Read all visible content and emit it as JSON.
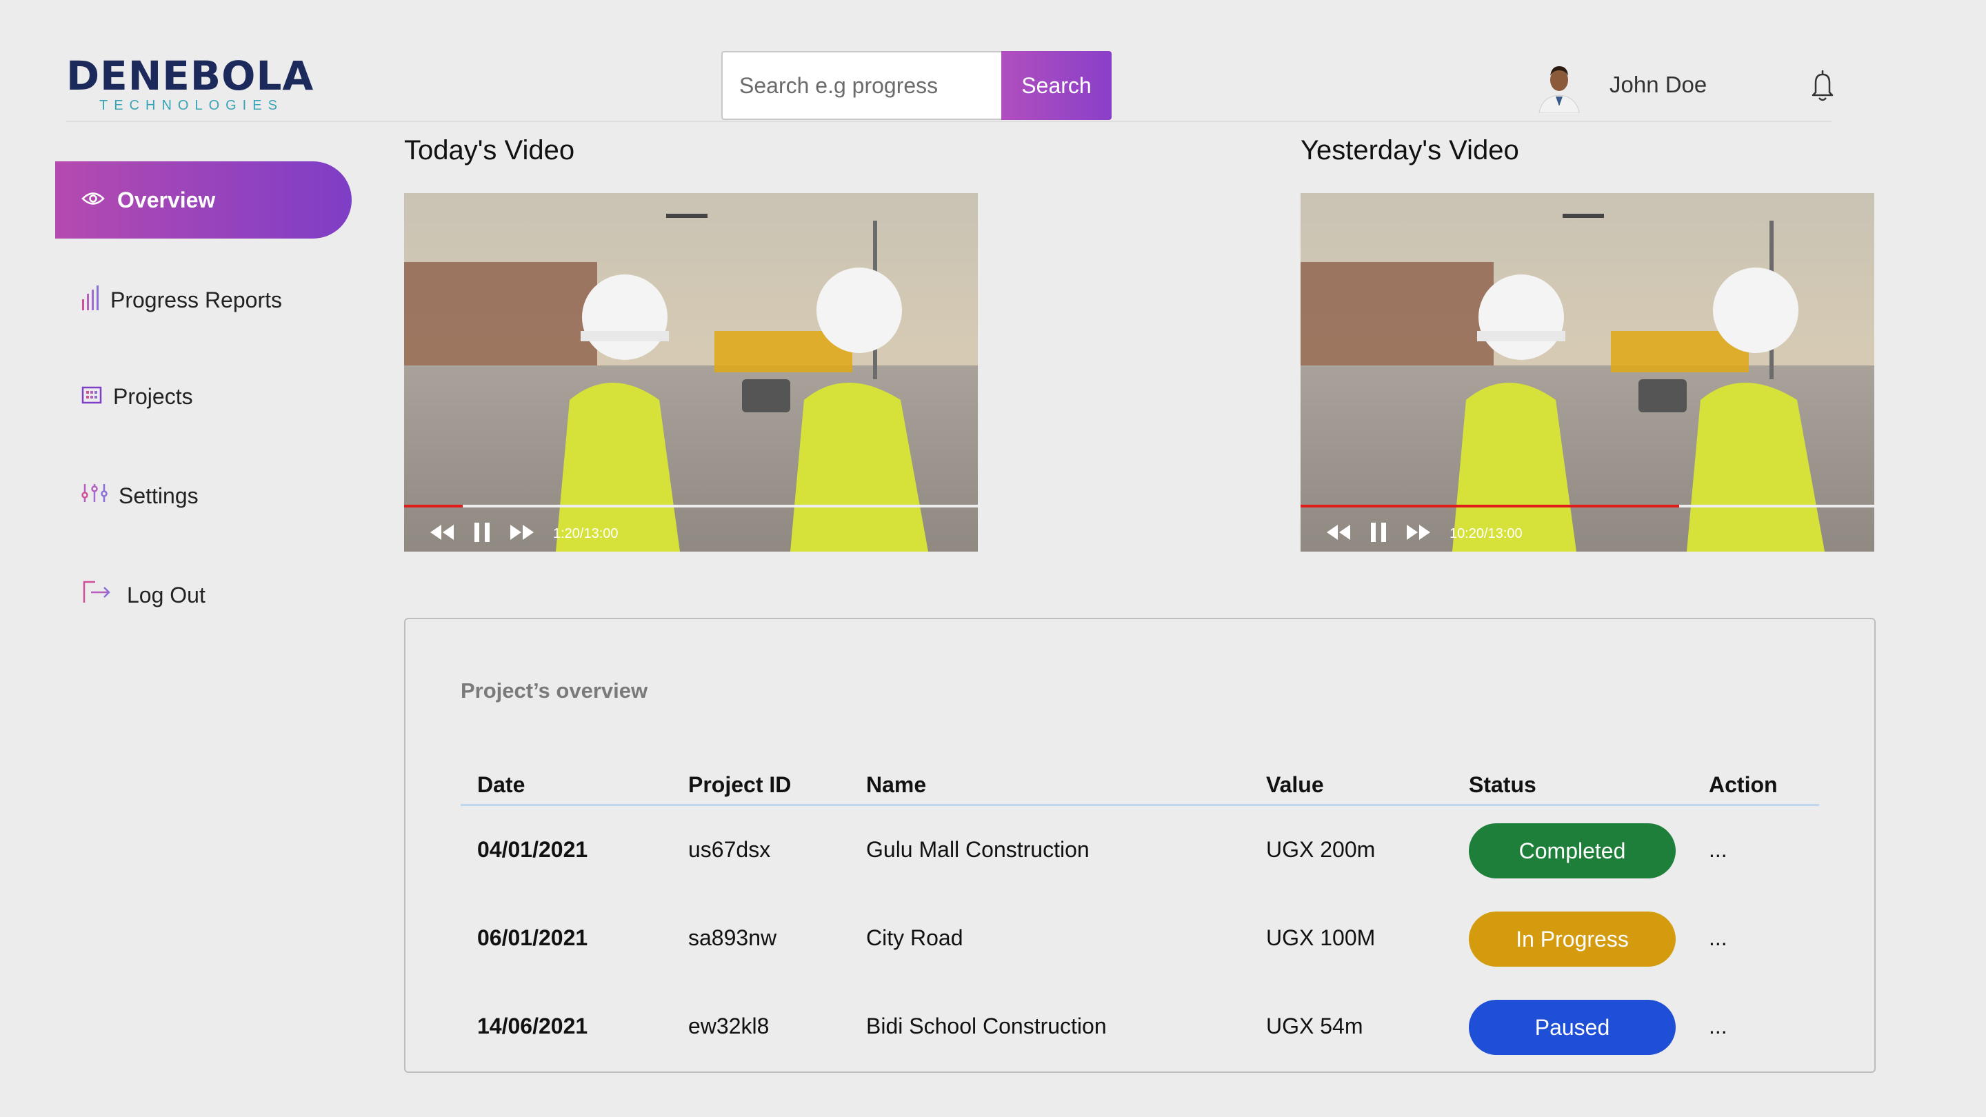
{
  "brand": {
    "name": "DENEBOLA",
    "subtitle": "TECHNOLOGIES"
  },
  "header": {
    "search_placeholder": "Search e.g progress",
    "search_button": "Search",
    "user_name": "John Doe"
  },
  "sidebar": {
    "items": [
      {
        "label": "Overview",
        "icon": "eye-icon",
        "active": true
      },
      {
        "label": "Progress Reports",
        "icon": "bar-chart-icon"
      },
      {
        "label": "Projects",
        "icon": "building-icon"
      },
      {
        "label": "Settings",
        "icon": "sliders-icon"
      },
      {
        "label": "Log Out",
        "icon": "logout-icon"
      }
    ]
  },
  "videos": [
    {
      "title": "Today's Video",
      "time": "1:20/13:00",
      "progress": 0.1026
    },
    {
      "title": "Yesterday's Video",
      "time": "10:20/13:00",
      "progress": 0.6603
    }
  ],
  "overview": {
    "title": "Project’s overview",
    "columns": [
      "Date",
      "Project ID",
      "Name",
      "Value",
      "Status",
      "Action"
    ],
    "rows": [
      {
        "date": "04/01/2021",
        "id": "us67dsx",
        "name": "Gulu Mall Construction",
        "value": "UGX 200m",
        "status": "Completed",
        "action": "..."
      },
      {
        "date": "06/01/2021",
        "id": "sa893nw",
        "name": "City Road",
        "value": "UGX 100M",
        "status": "In Progress",
        "action": "..."
      },
      {
        "date": "14/06/2021",
        "id": "ew32kl8",
        "name": "Bidi School Construction",
        "value": "UGX 54m",
        "status": "Paused",
        "action": "..."
      }
    ],
    "status_colors": {
      "Completed": "#1e7f3b",
      "In Progress": "#d39b0d",
      "Paused": "#1f4fd6"
    }
  },
  "colors": {
    "accent_start": "#b54ab0",
    "accent_end": "#7e3ec6",
    "progress": "#e21b1b"
  }
}
